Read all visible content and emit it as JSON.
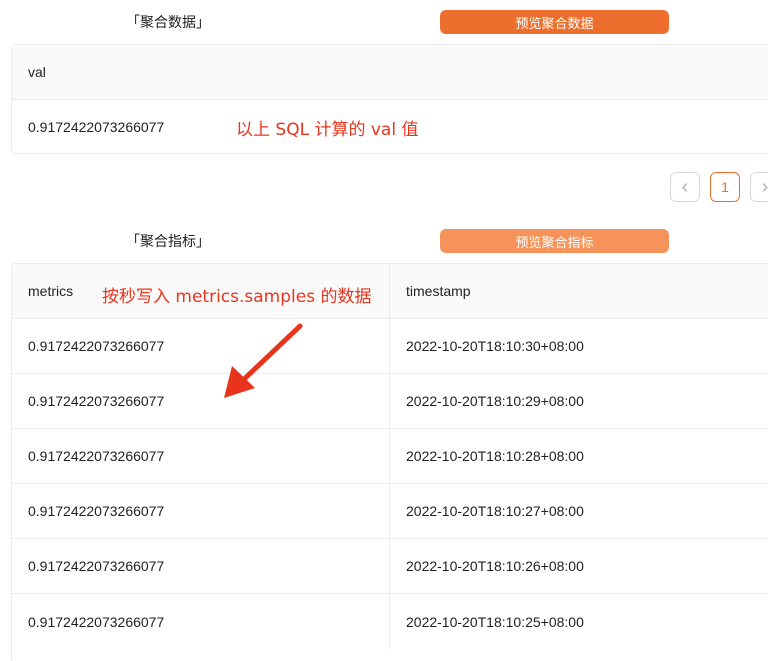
{
  "aggregate_data": {
    "label": "「聚合数据」",
    "preview_button": "预览聚合数据",
    "column": "val",
    "value": "0.9172422073266077",
    "annotation": "以上 SQL 计算的 val 值"
  },
  "pagination": {
    "current_page": "1",
    "prev_icon": "‹",
    "next_icon": "›"
  },
  "aggregate_metrics": {
    "label": "「聚合指标」",
    "preview_button": "预览聚合指标",
    "columns": [
      "metrics",
      "timestamp"
    ],
    "annotation": "按秒写入 metrics.samples 的数据",
    "rows": [
      {
        "metrics": "0.9172422073266077",
        "timestamp": "2022-10-20T18:10:30+08:00"
      },
      {
        "metrics": "0.9172422073266077",
        "timestamp": "2022-10-20T18:10:29+08:00"
      },
      {
        "metrics": "0.9172422073266077",
        "timestamp": "2022-10-20T18:10:28+08:00"
      },
      {
        "metrics": "0.9172422073266077",
        "timestamp": "2022-10-20T18:10:27+08:00"
      },
      {
        "metrics": "0.9172422073266077",
        "timestamp": "2022-10-20T18:10:26+08:00"
      },
      {
        "metrics": "0.9172422073266077",
        "timestamp": "2022-10-20T18:10:25+08:00"
      }
    ]
  },
  "colors": {
    "primary_button": "#ee6f2d",
    "secondary_button": "#f6935a",
    "annotation_red": "#e8341c",
    "page_active": "#ee6f2d"
  },
  "icons": {
    "arrow": "red-arrow-icon"
  }
}
